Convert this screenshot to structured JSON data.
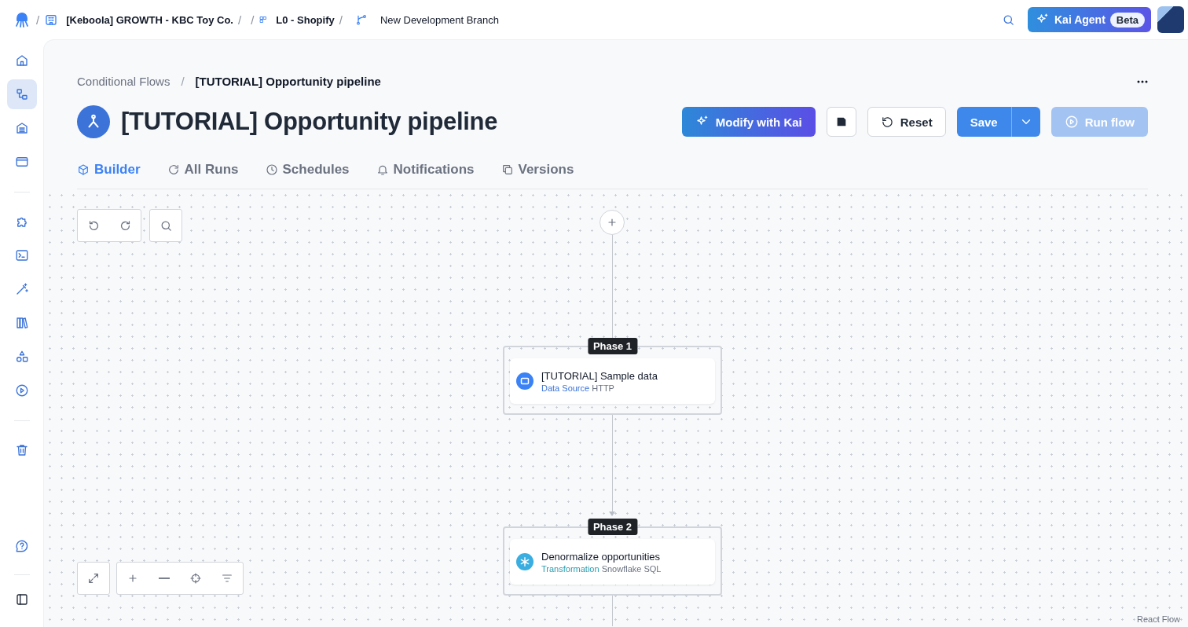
{
  "topbar": {
    "crumbs": [
      {
        "kind": "separator",
        "label": "/"
      },
      {
        "kind": "project",
        "label": "[Keboola] GROWTH - KBC Toy Co."
      },
      {
        "kind": "separator",
        "label": "/"
      },
      {
        "kind": "separator",
        "label": "/"
      },
      {
        "kind": "folder",
        "label": "L0 - Shopify"
      },
      {
        "kind": "separator",
        "label": "/"
      },
      {
        "kind": "branch",
        "label": "New Development Branch"
      }
    ],
    "kai_agent": {
      "label": "Kai Agent",
      "badge": "Beta"
    }
  },
  "sidebar": {
    "groups": [
      [
        {
          "selected": false
        },
        {
          "selected": true
        },
        {
          "selected": false
        },
        {
          "selected": false
        }
      ],
      [
        {
          "selected": false
        },
        {
          "selected": false
        },
        {
          "selected": false
        },
        {
          "selected": false
        },
        {
          "selected": false
        },
        {
          "selected": false
        }
      ],
      [
        {
          "selected": false
        }
      ]
    ]
  },
  "breadcrumb": [
    "Conditional Flows",
    "/",
    "[TUTORIAL] Opportunity pipeline"
  ],
  "title": "[TUTORIAL] Opportunity pipeline",
  "actions": {
    "modify": "Modify with Kai",
    "reset": "Reset",
    "save": "Save",
    "run": {
      "label": "Run flow",
      "disabled": true
    }
  },
  "tabs": [
    {
      "label": "Builder",
      "selected": true
    },
    {
      "label": "All Runs",
      "selected": false
    },
    {
      "label": "Schedules",
      "selected": false
    },
    {
      "label": "Notifications",
      "selected": false
    },
    {
      "label": "Versions",
      "selected": false
    }
  ],
  "canvas": {
    "phases": [
      {
        "label": "Phase 1",
        "tasks": [
          {
            "kind": "source",
            "name": "[TUTORIAL] Sample data",
            "type": "Data Source",
            "component": "HTTP"
          }
        ]
      },
      {
        "label": "Phase 2",
        "tasks": [
          {
            "kind": "transformation",
            "name": "Denormalize opportunities",
            "type": "Transformation",
            "component": "Snowflake SQL"
          }
        ]
      }
    ],
    "attribution": "React Flow"
  }
}
